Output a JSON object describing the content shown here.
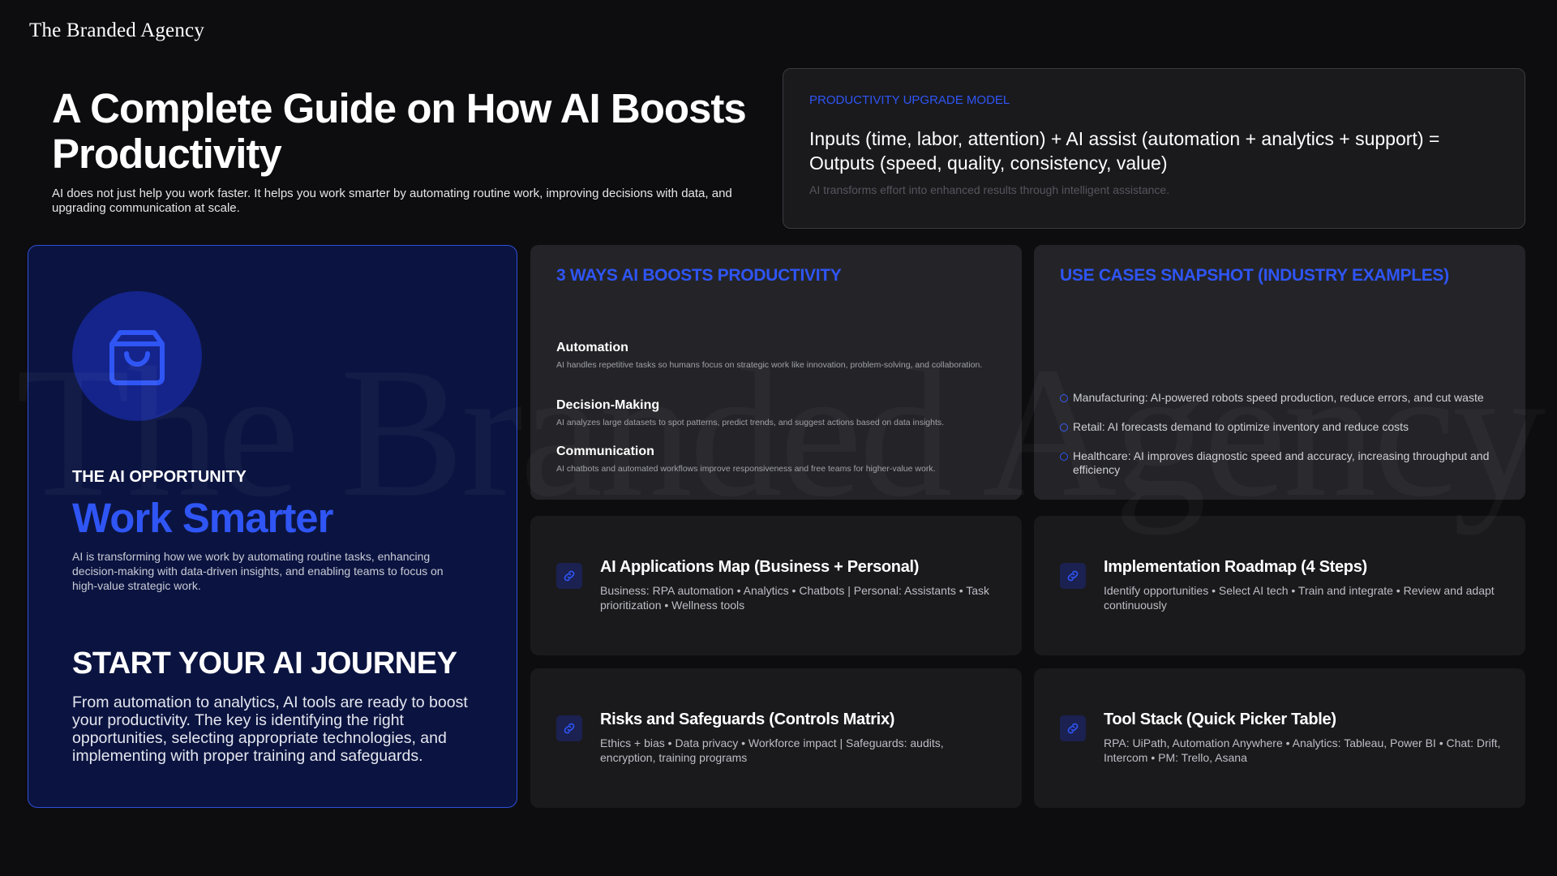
{
  "brand": {
    "logo_text": "The Branded Agency",
    "accent": "#2f55f5"
  },
  "hero": {
    "title": "A Complete Guide on How AI Boosts Productivity",
    "subtitle": "AI does not just help you work faster. It helps you work smarter by automating routine work, improving decisions with data, and upgrading communication at scale."
  },
  "model": {
    "kicker": "PRODUCTIVITY UPGRADE MODEL",
    "formula": "Inputs (time, labor, attention) + AI assist (automation + analytics + support) = Outputs (speed, quality, consistency, value)",
    "note": "AI transforms effort into enhanced results through intelligent assistance."
  },
  "opportunity": {
    "icon": "shopping-bag-icon",
    "kicker": "THE AI OPPORTUNITY",
    "headline": "Work Smarter",
    "description": "AI is transforming how we work by automating routine tasks, enhancing decision-making with data-driven insights, and enabling teams to focus on high-value strategic work.",
    "journey_title": "START YOUR AI JOURNEY",
    "journey_body": "From automation to analytics, AI tools are ready to boost your productivity. The key is identifying the right opportunities, selecting appropriate technologies, and implementing with proper training and safeguards."
  },
  "ways": {
    "title": "3 WAYS AI BOOSTS PRODUCTIVITY",
    "items": [
      {
        "title": "Automation",
        "desc": "AI handles repetitive tasks so humans focus on strategic work like innovation, problem-solving, and collaboration."
      },
      {
        "title": "Decision-Making",
        "desc": "AI analyzes large datasets to spot patterns, predict trends, and suggest actions based on data insights."
      },
      {
        "title": "Communication",
        "desc": "AI chatbots and automated workflows improve responsiveness and free teams for higher-value work."
      }
    ]
  },
  "cases": {
    "title": "USE CASES SNAPSHOT (INDUSTRY EXAMPLES)",
    "items": [
      "Manufacturing: AI-powered robots speed production, reduce errors, and cut waste",
      "Retail: AI forecasts demand to optimize inventory and reduce costs",
      "Healthcare: AI improves diagnostic speed and accuracy, increasing throughput and efficiency"
    ]
  },
  "tiles": [
    {
      "icon": "link-icon",
      "title": "AI Applications Map (Business + Personal)",
      "desc": "Business: RPA automation • Analytics • Chatbots | Personal: Assistants • Task prioritization • Wellness tools"
    },
    {
      "icon": "link-icon",
      "title": "Implementation Roadmap (4 Steps)",
      "desc": "Identify opportunities • Select AI tech • Train and integrate • Review and adapt continuously"
    },
    {
      "icon": "link-icon",
      "title": "Risks and Safeguards (Controls Matrix)",
      "desc": "Ethics + bias • Data privacy • Workforce impact | Safeguards: audits, encryption, training programs"
    },
    {
      "icon": "link-icon",
      "title": "Tool Stack (Quick Picker Table)",
      "desc": "RPA: UiPath, Automation Anywhere • Analytics: Tableau, Power BI • Chat: Drift, Intercom • PM: Trello, Asana"
    }
  ]
}
